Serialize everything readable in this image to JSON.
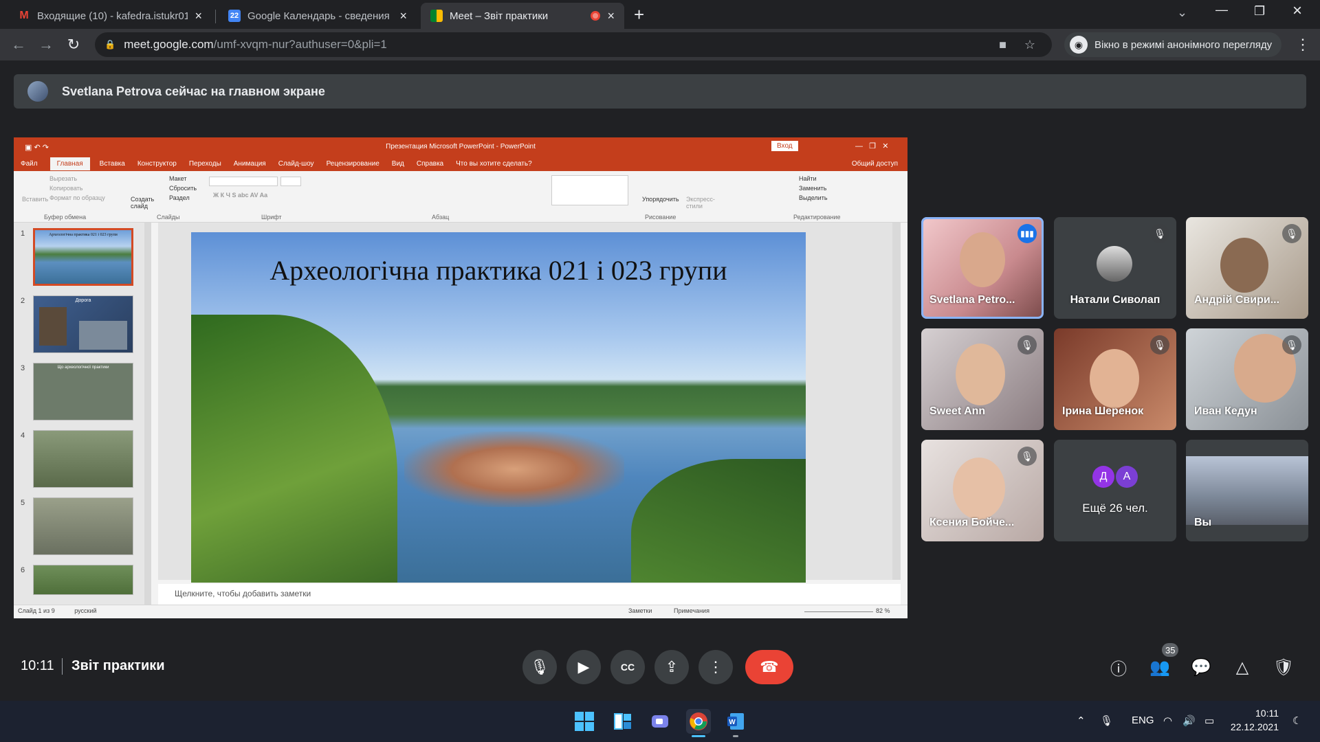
{
  "browser": {
    "tabs": [
      {
        "title": "Входящие (10) - kafedra.istukr01",
        "icon": "gmail-icon"
      },
      {
        "title": "Google Календарь - сведения о",
        "icon": "calendar-icon",
        "icon_text": "22"
      },
      {
        "title": "Meet – Звіт практики",
        "icon": "meet-icon",
        "recording": true
      }
    ],
    "url_host": "meet.google.com",
    "url_path": "/umf-xvqm-nur?authuser=0&pli=1",
    "incognito_label": "Вікно в режимі анонімного перегляду"
  },
  "banner": {
    "text": "Svetlana Petrova сейчас на главном экране"
  },
  "ppt": {
    "window_title": "Презентация Microsoft PowerPoint  -  PowerPoint",
    "signin": "Вход",
    "ribbon_tabs": [
      "Файл",
      "Главная",
      "Вставка",
      "Конструктор",
      "Переходы",
      "Анимация",
      "Слайд-шоу",
      "Рецензирование",
      "Вид",
      "Справка",
      "Что вы хотите сделать?"
    ],
    "share": "Общий доступ",
    "ribbon_items": {
      "paste": "Вставить",
      "cut": "Вырезать",
      "copy": "Копировать",
      "format": "Формат по образцу",
      "create": "Создать слайд",
      "layout": "Макет",
      "reset": "Сбросить",
      "section": "Раздел",
      "arrange": "Упорядочить",
      "express": "Экспресс-стили",
      "find": "Найти",
      "replace": "Заменить",
      "select": "Выделить"
    },
    "ribbon_groups": [
      "Буфер обмена",
      "Слайды",
      "Шрифт",
      "Абзац",
      "Рисование",
      "Редактирование"
    ],
    "slide_numbers": [
      "1",
      "2",
      "3",
      "4",
      "5",
      "6"
    ],
    "thumb_captions": [
      "Археологічна практика 021 і 023 групи",
      "Дорога",
      "Що археологічної практики"
    ],
    "slide_title": "Археологічна практика 021 і 023 групи",
    "notes_placeholder": "Щелкните, чтобы добавить заметки",
    "status_left": "Слайд 1 из 9",
    "status_lang": "русский",
    "status_notes": "Заметки",
    "status_comments": "Примечания",
    "zoom": "82 %"
  },
  "participants": [
    {
      "name": "Svetlana Petro...",
      "speaking": true
    },
    {
      "name": "Натали Сиволап",
      "muted": true
    },
    {
      "name": "Андрій Свири...",
      "muted": true
    },
    {
      "name": "Sweet Ann",
      "muted": true
    },
    {
      "name": "Ірина Шеренок",
      "muted": true
    },
    {
      "name": "Иван Кедун",
      "muted": true
    },
    {
      "name": "Ксения Бойче...",
      "muted": true
    },
    {
      "name": "Ещё 26 чел.",
      "avatars": [
        "Д",
        "А"
      ]
    },
    {
      "name": "Вы"
    }
  ],
  "meetbar": {
    "time": "10:11",
    "meeting_title": "Звіт практики",
    "people_count": "35"
  },
  "taskbar": {
    "lang": "ENG",
    "time": "10:11",
    "date": "22.12.2021"
  },
  "colors": {
    "end_call": "#ea4335",
    "ppt_accent": "#c43e1c",
    "speaking": "#1a73e8"
  }
}
